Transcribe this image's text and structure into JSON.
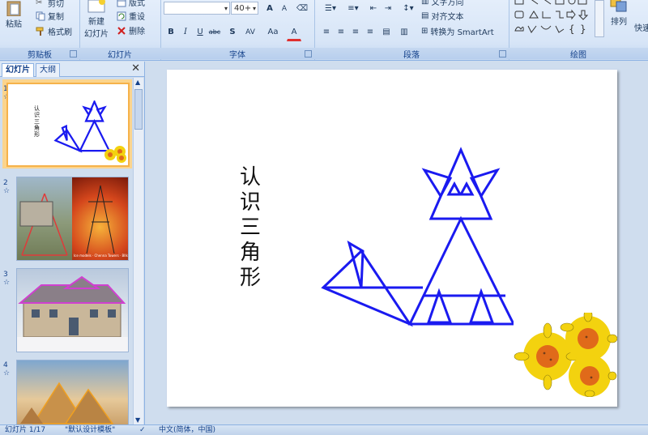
{
  "ribbon": {
    "clipboard": {
      "paste": "粘贴",
      "cut": "剪切",
      "copy": "复制",
      "format_painter": "格式刷",
      "label": "剪贴板"
    },
    "slides": {
      "new_slide": "新建",
      "new_slide2": "幻灯片",
      "layout": "版式",
      "reset": "重设",
      "delete": "删除",
      "label": "幻灯片"
    },
    "font": {
      "font_size": "40+",
      "grow": "A",
      "shrink": "A",
      "bold": "B",
      "italic": "I",
      "underline": "U",
      "strike": "abc",
      "shadow": "S",
      "spacing": "AV",
      "case": "Aa",
      "color": "A",
      "label": "字体"
    },
    "paragraph": {
      "text_direction": "文字方向",
      "align_text": "对齐文本",
      "smartart": "转换为 SmartArt",
      "label": "段落"
    },
    "drawing": {
      "arrange": "排列",
      "quick_styles": "快速",
      "label": "绘图"
    }
  },
  "panel": {
    "tab_slides": "幻灯片",
    "tab_outline": "大纲",
    "close": "✕",
    "thumbs": [
      {
        "num": "1",
        "star": "☆"
      },
      {
        "num": "2",
        "star": "☆"
      },
      {
        "num": "3",
        "star": "☆"
      },
      {
        "num": "4",
        "star": "☆"
      }
    ],
    "thumb1_title": "认识三角形",
    "thumb2_caption": "Ice models · Chenna Towers · Bllk"
  },
  "slide": {
    "title_chars": [
      "认",
      "识",
      "三",
      "角",
      "形"
    ],
    "colors": {
      "shape": "#1a1af0",
      "flower_petal": "#f3d20f",
      "flower_center": "#e06a1a"
    }
  },
  "status": {
    "slide": "幻灯片 1/17",
    "theme": "\"默认设计模板\"",
    "lang": "中文(简体，中国)"
  }
}
